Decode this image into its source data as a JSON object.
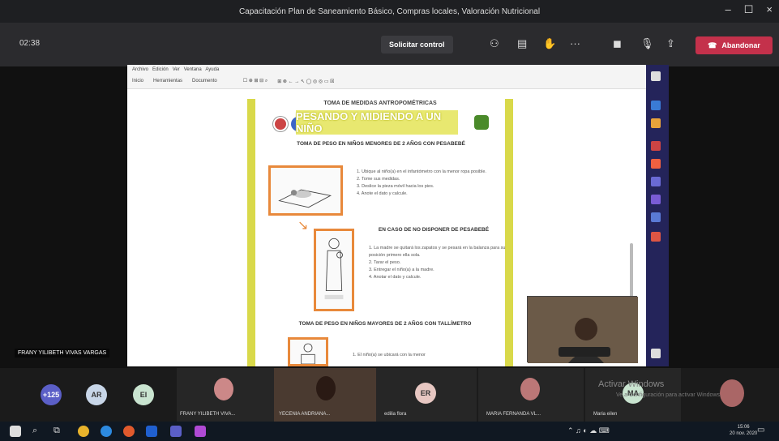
{
  "window": {
    "title": "Capacitación Plan de Saneamiento Básico, Compras locales, Valoración Nutricional"
  },
  "meeting": {
    "timer": "02:38",
    "request_control": "Solicitar control",
    "leave_label": "Abandonar"
  },
  "document": {
    "header": "TOMA DE MEDIDAS ANTROPOMÉTRICAS",
    "banner": "PESANDO Y MIDIENDO A UN NIÑO",
    "section1": "TOMA DE PESO EN NIÑOS MENORES DE 2 AÑOS CON PESABEBÉ",
    "steps1": [
      "1. Ubique al niño(a) en el infantómetro con la menor ropa posible.",
      "2. Tome sus medidas.",
      "3. Deslice la pieza móvil hacia los pies.",
      "4. Anote el dato y calcule."
    ],
    "section2": "EN CASO DE NO DISPONER DE PESABEBÉ",
    "steps2": [
      "1. La madre se quitará los zapatos y se pesará en la balanza para su posición primero ella sola.",
      "2. Tarar el peso.",
      "3. Entregar el niño(a) a la madre.",
      "4. Anotar el dato y calcule."
    ],
    "section3": "TOMA DE PESO EN NIÑOS MAYORES DE 2 AÑOS CON TALLÍMETRO",
    "steps3": [
      "1. El niño(a) se ubicará con la menor"
    ]
  },
  "presenter": {
    "name": "FRANY YILIBETH VIVAS VARGAS"
  },
  "participants": [
    {
      "initials": "+125",
      "color": "#5b5fc7"
    },
    {
      "initials": "AR",
      "color": "#c8d6e8"
    },
    {
      "initials": "EI",
      "color": "#c9e4d0"
    },
    {
      "name": "FRANY YILIBETH VIVA..."
    },
    {
      "name": "YECENIA ANDRIANA..."
    },
    {
      "initials": "ER",
      "name": "edilia flora",
      "color": "#e7c7c2"
    },
    {
      "name": "MARIA FERNANDA VL..."
    },
    {
      "initials": "MA",
      "name": "Maria eilen",
      "color": "#c9e4d0"
    }
  ],
  "os": {
    "activate_title": "Activar Windows",
    "activate_sub": "Ve a Configuración para activar Windows.",
    "time": "15:06",
    "date": "20 nov. 2020"
  }
}
